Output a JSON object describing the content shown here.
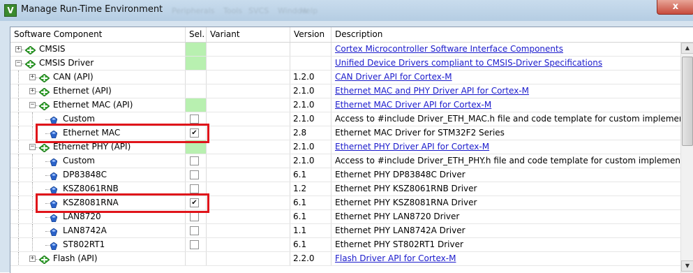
{
  "window": {
    "title": "Manage Run-Time Environment",
    "close_label": "x",
    "app_icon_letter": "V",
    "ghost_menus": [
      "Peripherals",
      "Tools",
      "SVCS",
      "Window",
      "Help"
    ]
  },
  "columns": {
    "component": "Software Component",
    "sel": "Sel.",
    "variant": "Variant",
    "version": "Version",
    "description": "Description"
  },
  "rows": [
    {
      "name": "CMSIS",
      "level": 0,
      "expander": "+",
      "icon": "green-diamond-icon",
      "sel": "green",
      "version": "",
      "desc": "Cortex Microcontroller Software Interface Components",
      "link": true
    },
    {
      "name": "CMSIS Driver",
      "level": 0,
      "expander": "-",
      "icon": "green-diamond-icon",
      "sel": "green",
      "version": "",
      "desc": "Unified Device Drivers compliant to CMSIS-Driver Specifications",
      "link": true
    },
    {
      "name": "CAN (API)",
      "level": 1,
      "expander": "+",
      "icon": "green-diamond-icon",
      "sel": "none",
      "version": "1.2.0",
      "desc": "CAN Driver API for Cortex-M",
      "link": true
    },
    {
      "name": "Ethernet (API)",
      "level": 1,
      "expander": "+",
      "icon": "green-diamond-icon",
      "sel": "none",
      "version": "2.1.0",
      "desc": "Ethernet MAC and PHY Driver API for Cortex-M",
      "link": true
    },
    {
      "name": "Ethernet MAC (API)",
      "level": 1,
      "expander": "-",
      "icon": "green-diamond-icon",
      "sel": "green",
      "version": "2.1.0",
      "desc": "Ethernet MAC Driver API for Cortex-M",
      "link": true
    },
    {
      "name": "Custom",
      "level": 2,
      "expander": "",
      "icon": "blue-gem-icon",
      "sel": "unchecked",
      "version": "2.1.0",
      "desc": "Access to #include Driver_ETH_MAC.h file and code template for custom implementation",
      "link": false
    },
    {
      "name": "Ethernet MAC",
      "level": 2,
      "expander": "",
      "icon": "blue-gem-icon",
      "sel": "checked",
      "version": "2.8",
      "desc": "Ethernet MAC Driver for STM32F2 Series",
      "link": false
    },
    {
      "name": "Ethernet PHY (API)",
      "level": 1,
      "expander": "-",
      "icon": "green-diamond-icon",
      "sel": "green",
      "version": "2.1.0",
      "desc": "Ethernet PHY Driver API for Cortex-M",
      "link": true
    },
    {
      "name": "Custom",
      "level": 2,
      "expander": "",
      "icon": "blue-gem-icon",
      "sel": "unchecked",
      "version": "2.1.0",
      "desc": "Access to #include Driver_ETH_PHY.h file and code template for custom implementation",
      "link": false
    },
    {
      "name": "DP83848C",
      "level": 2,
      "expander": "",
      "icon": "blue-gem-icon",
      "sel": "unchecked",
      "version": "6.1",
      "desc": "Ethernet PHY DP83848C Driver",
      "link": false
    },
    {
      "name": "KSZ8061RNB",
      "level": 2,
      "expander": "",
      "icon": "blue-gem-icon",
      "sel": "unchecked",
      "version": "1.2",
      "desc": "Ethernet PHY KSZ8061RNB Driver",
      "link": false
    },
    {
      "name": "KSZ8081RNA",
      "level": 2,
      "expander": "",
      "icon": "blue-gem-icon",
      "sel": "checked",
      "version": "6.1",
      "desc": "Ethernet PHY KSZ8081RNA Driver",
      "link": false
    },
    {
      "name": "LAN8720",
      "level": 2,
      "expander": "",
      "icon": "blue-gem-icon",
      "sel": "unchecked",
      "version": "6.1",
      "desc": "Ethernet PHY LAN8720 Driver",
      "link": false
    },
    {
      "name": "LAN8742A",
      "level": 2,
      "expander": "",
      "icon": "blue-gem-icon",
      "sel": "unchecked",
      "version": "1.1",
      "desc": "Ethernet PHY LAN8742A Driver",
      "link": false
    },
    {
      "name": "ST802RT1",
      "level": 2,
      "expander": "",
      "icon": "blue-gem-icon",
      "sel": "unchecked",
      "version": "6.1",
      "desc": "Ethernet PHY ST802RT1 Driver",
      "link": false
    },
    {
      "name": "Flash (API)",
      "level": 1,
      "expander": "+",
      "icon": "green-diamond-icon",
      "sel": "none",
      "version": "2.2.0",
      "desc": "Flash Driver API for Cortex-M",
      "link": true
    }
  ],
  "highlighted_rows": [
    "Ethernet MAC",
    "KSZ8081RNA"
  ],
  "colors": {
    "sel_green": "#b8f0b0",
    "link_blue": "#1a1acc",
    "highlight_red": "#e0141a",
    "title_bar": "#c9dced"
  }
}
